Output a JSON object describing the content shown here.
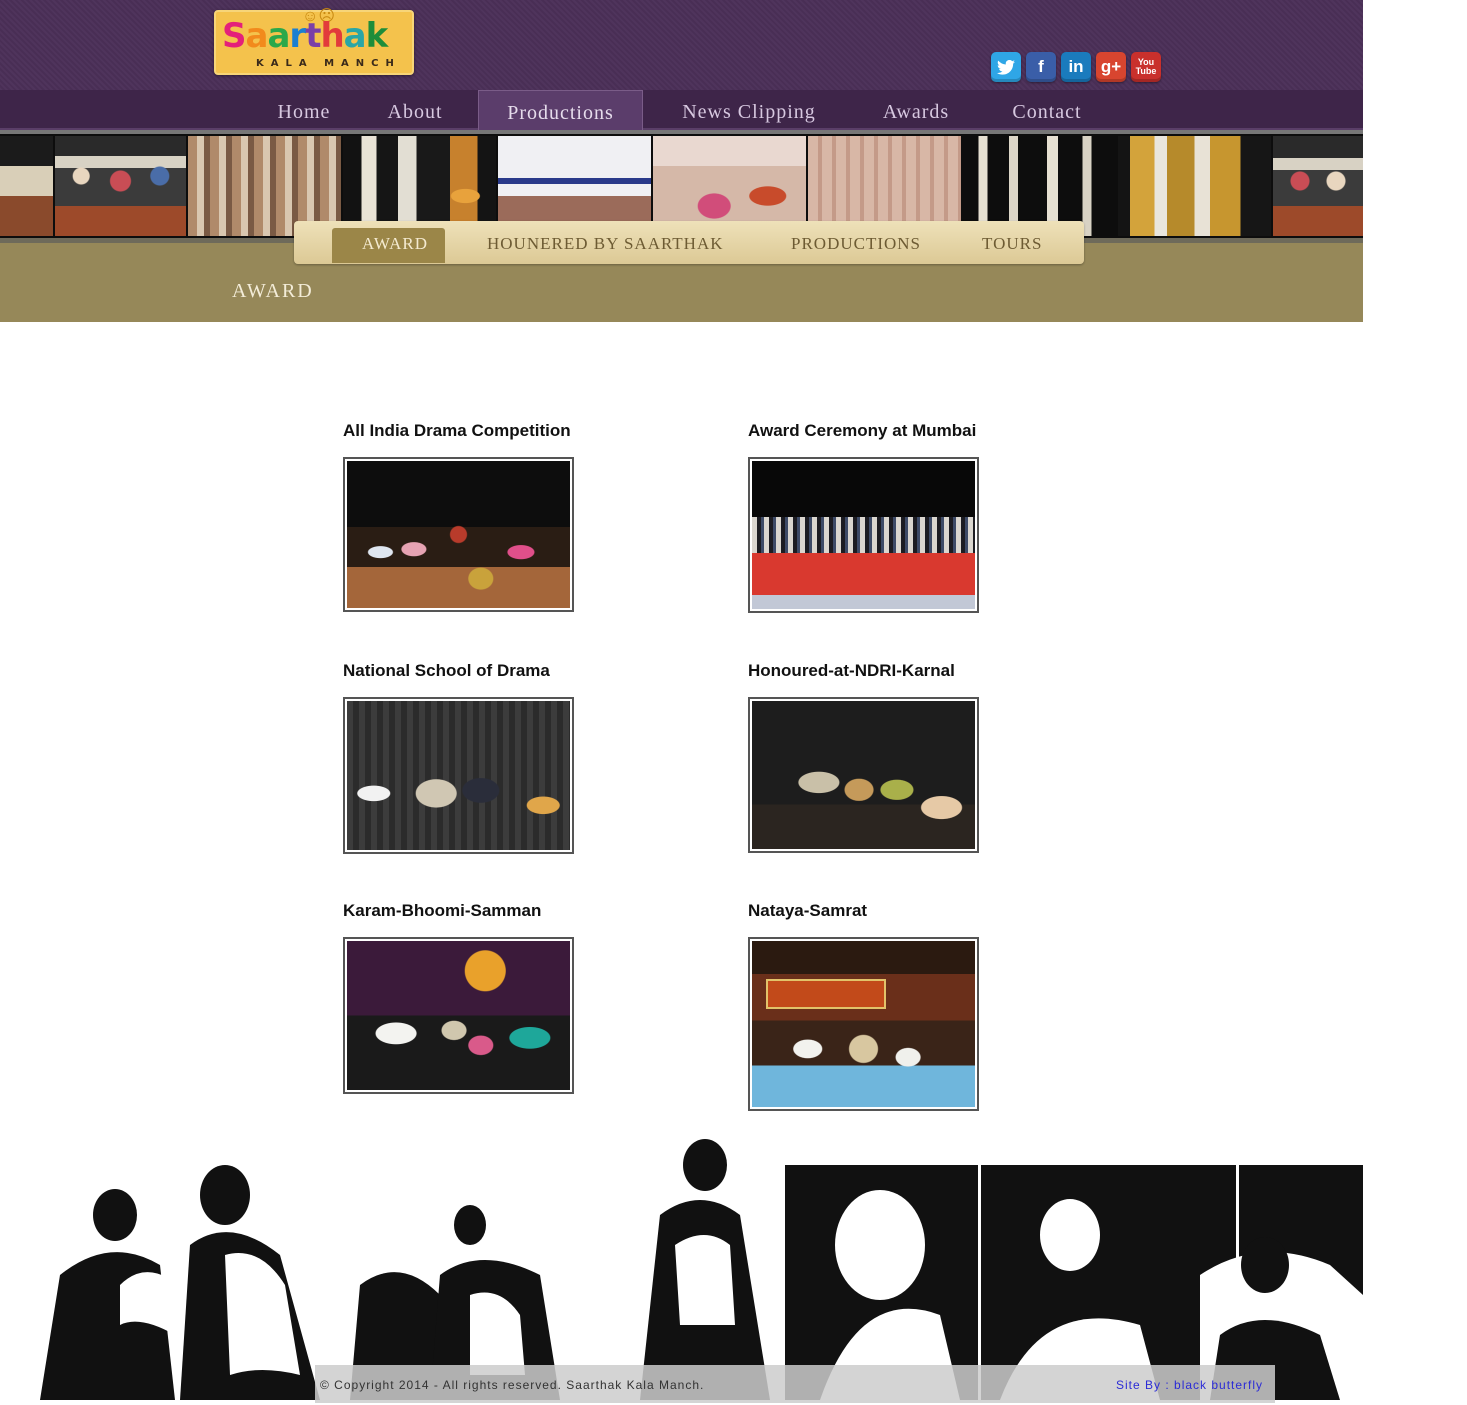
{
  "logo": {
    "letters": [
      "S",
      "a",
      "a",
      "r",
      "t",
      "h",
      "a",
      "k"
    ],
    "subtitle": "KALA MANCH"
  },
  "social": [
    {
      "name": "twitter-icon",
      "glyph": "🐦"
    },
    {
      "name": "facebook-icon",
      "glyph": "f"
    },
    {
      "name": "linkedin-icon",
      "glyph": "in"
    },
    {
      "name": "google-plus-icon",
      "glyph": "g+"
    },
    {
      "name": "youtube-icon",
      "glyph": "You Tube"
    }
  ],
  "nav": {
    "items": [
      "Home",
      "About",
      "Productions",
      "News Clipping",
      "Awards",
      "Contact"
    ],
    "active": "Productions"
  },
  "submenu": {
    "items": [
      "AWARD",
      "HOUNERED BY SAARTHAK",
      "PRODUCTIONS",
      "TOURS"
    ],
    "active": "AWARD"
  },
  "page_title": "AWARD",
  "awards": [
    {
      "title": "All India Drama Competition"
    },
    {
      "title": "Award Ceremony at Mumbai"
    },
    {
      "title": "National School of Drama"
    },
    {
      "title": "Honoured-at-NDRI-Karnal"
    },
    {
      "title": "Karam-Bhoomi-Samman"
    },
    {
      "title": "Nataya-Samrat"
    }
  ],
  "footer": {
    "copyright": "© Copyright 2014 - All rights reserved. Saarthak Kala Manch.",
    "site_by": "Site By : black butterfly"
  },
  "colors": {
    "header_purple": "#4b2f58",
    "nav_purple": "#3e2549",
    "band_khaki": "#968859",
    "submenu_cream": "#eee1b9"
  }
}
